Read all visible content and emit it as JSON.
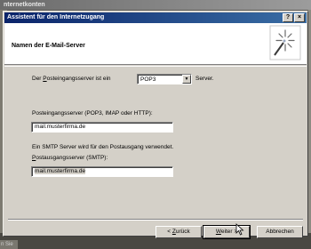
{
  "background_window": {
    "title": "nternetkonten",
    "status_text": "n Sie"
  },
  "dialog": {
    "title": "Assistent für den Internetzugang",
    "title_buttons": [
      "?",
      "×"
    ],
    "header": {
      "title": "Namen der E-Mail-Server",
      "icon": "wizard-sparkle-icon"
    },
    "incoming_type": {
      "label_prefix": "Der ",
      "label_underlined": "P",
      "label_rest": "osteingangsserver ist ein",
      "selected": "POP3",
      "suffix": "Server."
    },
    "incoming_server": {
      "label": "Posteingangsserver (POP3, IMAP oder HTTP):",
      "value": "mail.musterfirma.de"
    },
    "smtp_note": "Ein SMTP Server wird für den Postausgang verwendet.",
    "outgoing_server": {
      "label_underlined": "P",
      "label_rest": "ostausgangsserver (SMTP):",
      "value": "mail.musterfirma.de"
    },
    "buttons": {
      "back_prefix": "< ",
      "back_underlined": "Z",
      "back_rest": "urück",
      "next_underlined": "W",
      "next_rest": "eiter >",
      "cancel": "Abbrechen"
    }
  },
  "colors": {
    "titlebar_start": "#0a246a",
    "titlebar_end": "#3a6ea5",
    "dialog_face": "#d4d0c8"
  }
}
